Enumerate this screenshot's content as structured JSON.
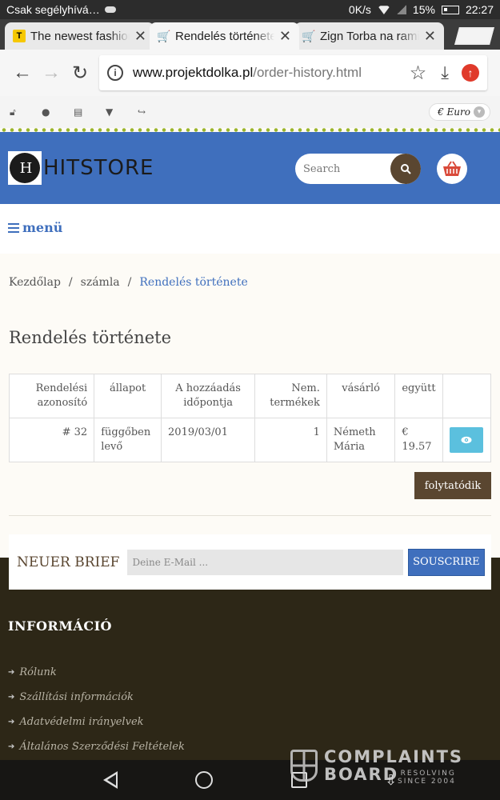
{
  "status_bar": {
    "carrier": "Csak segélyhívá…",
    "network": "0K/s",
    "battery": "15%",
    "time": "22:27"
  },
  "browser": {
    "tabs": [
      {
        "title": "The newest fashion",
        "favicon": "T",
        "close": "✕"
      },
      {
        "title": "Rendelés története",
        "favicon": "cart-icon",
        "close": "✕"
      },
      {
        "title": "Zign Torba na ramię",
        "favicon": "cart-icon",
        "close": "✕"
      }
    ],
    "url_host": "www.projektdolka.pl",
    "url_path": "/order-history.html"
  },
  "util_bar": {
    "currency": "€ Euro"
  },
  "header": {
    "logo_mark": "H",
    "logo_text": "HITSTORE",
    "search_placeholder": "Search"
  },
  "menu": {
    "label": "menü"
  },
  "breadcrumb": {
    "home": "Kezdőlap",
    "sep": "/",
    "account": "számla",
    "current": "Rendelés története"
  },
  "page_title": "Rendelés története",
  "orders_table": {
    "headers": [
      "Rendelési azonosító",
      "állapot",
      "A hozzáadás időpontja",
      "Nem. termékek",
      "vásárló",
      "együtt",
      ""
    ],
    "rows": [
      {
        "id": "# 32",
        "status": "függőben levő",
        "date": "2019/03/01",
        "items": "1",
        "customer": "Németh Mária",
        "total": "€ 19.57"
      }
    ]
  },
  "continue_label": "folytatódik",
  "newsletter": {
    "label": "NEUER BRIEF",
    "placeholder": "Deine E-Mail ...",
    "button": "SOUSCRIRE"
  },
  "footer": {
    "title": "INFORMÁCIÓ",
    "links": [
      "Rólunk",
      "Szállítási információk",
      "Adatvédelmi irányelvek",
      "Általános Szerződési Feltételek"
    ]
  },
  "watermark": {
    "line1": "COMPLAINTS",
    "line2": "BOARD",
    "sub1": "RESOLVING",
    "sub2": "SINCE 2004"
  },
  "colors": {
    "brand_blue": "#3f6fbd",
    "brown": "#5a4630",
    "footer_bg": "#2d2717",
    "view_button": "#5bc0de"
  }
}
